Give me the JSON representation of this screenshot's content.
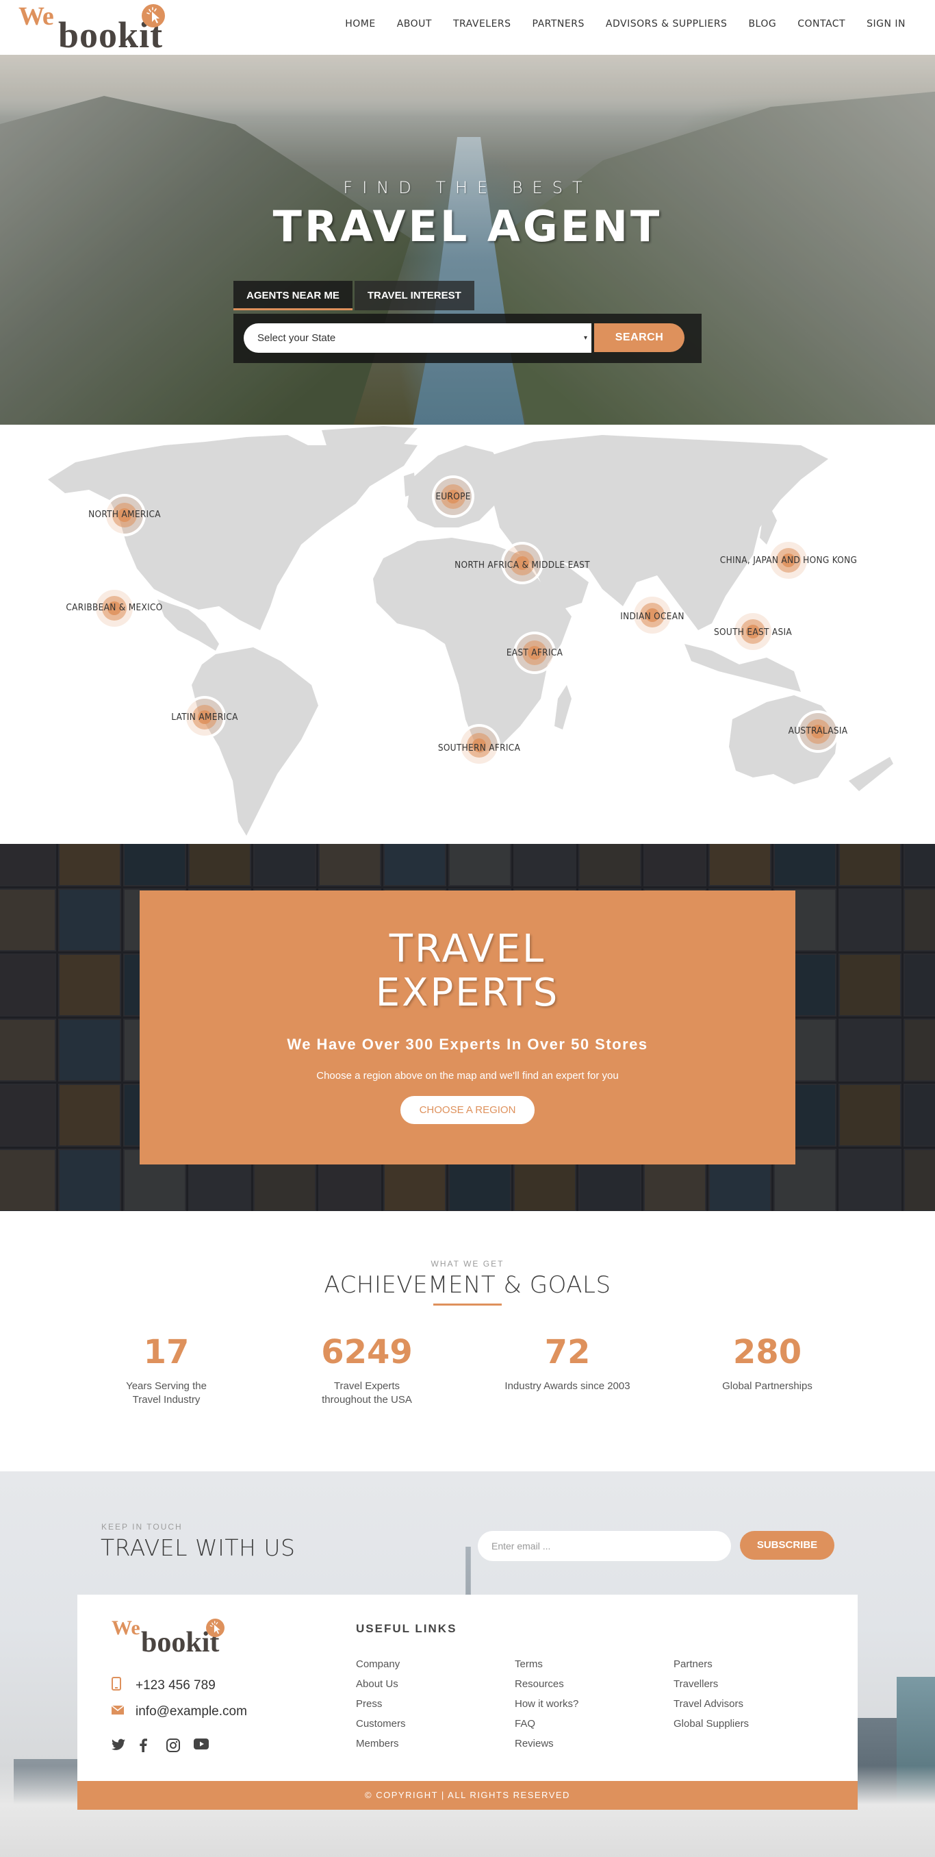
{
  "brand": {
    "we": "We",
    "bookit": "bookit",
    "accent": "#de915c",
    "text_dark": "#4a4440"
  },
  "nav": {
    "items": [
      {
        "label": "HOME"
      },
      {
        "label": "ABOUT"
      },
      {
        "label": "TRAVELERS"
      },
      {
        "label": "PARTNERS"
      },
      {
        "label": "ADVISORS & SUPPLIERS"
      },
      {
        "label": "BLOG"
      },
      {
        "label": "CONTACT"
      },
      {
        "label": "SIGN IN"
      }
    ]
  },
  "hero": {
    "kicker": "FIND THE BEST",
    "title": "TRAVEL AGENT",
    "tabs": [
      {
        "label": "AGENTS NEAR ME",
        "active": true
      },
      {
        "label": "TRAVEL INTEREST",
        "active": false
      }
    ],
    "select": {
      "value": "Select your State",
      "caret": "▾"
    },
    "search_label": "SEARCH"
  },
  "map": {
    "regions": [
      {
        "label": "NORTH AMERICA"
      },
      {
        "label": "CARIBBEAN & MEXICO"
      },
      {
        "label": "LATIN AMERICA"
      },
      {
        "label": "EUROPE"
      },
      {
        "label": "NORTH AFRICA & MIDDLE EAST"
      },
      {
        "label": "EAST AFRICA"
      },
      {
        "label": "SOUTHERN AFRICA"
      },
      {
        "label": "INDIAN OCEAN"
      },
      {
        "label": "CHINA, JAPAN AND HONG KONG"
      },
      {
        "label": "SOUTH EAST ASIA"
      },
      {
        "label": "AUSTRALASIA"
      }
    ]
  },
  "experts": {
    "title_line1": "TRAVEL",
    "title_line2": "EXPERTS",
    "subtitle": "We Have Over 300 Experts In Over 50 Stores",
    "description": "Choose a region above on the map and we'll find an expert for you",
    "button_label": "CHOOSE A REGION"
  },
  "achievements": {
    "kicker": "WHAT WE GET",
    "title": "ACHIEVEMENT & GOALS",
    "stats": [
      {
        "value": "17",
        "label": "Years Serving the Travel Industry"
      },
      {
        "value": "6249",
        "label": "Travel Experts throughout the USA"
      },
      {
        "value": "72",
        "label": "Industry Awards since 2003"
      },
      {
        "value": "280",
        "label": "Global Partnerships"
      }
    ]
  },
  "newsletter": {
    "kicker": "KEEP IN TOUCH",
    "title": "TRAVEL WITH US",
    "email_placeholder": "Enter email ...",
    "subscribe_label": "SUBSCRIBE"
  },
  "footer": {
    "phone": "+123 456 789",
    "email": "info@example.com",
    "socials": [
      {
        "icon": "twitter-icon"
      },
      {
        "icon": "facebook-icon"
      },
      {
        "icon": "instagram-icon"
      },
      {
        "icon": "youtube-icon"
      }
    ],
    "useful_links_title": "USEFUL LINKS",
    "links": [
      [
        "Company",
        "About Us",
        "Press",
        "Customers",
        "Members"
      ],
      [
        "Terms",
        "Resources",
        "How it works?",
        "FAQ",
        "Reviews"
      ],
      [
        "Partners",
        "Travellers",
        "Travel Advisors",
        "Global Suppliers"
      ]
    ],
    "copyright": "© COPYRIGHT | ALL RIGHTS RESERVED"
  }
}
